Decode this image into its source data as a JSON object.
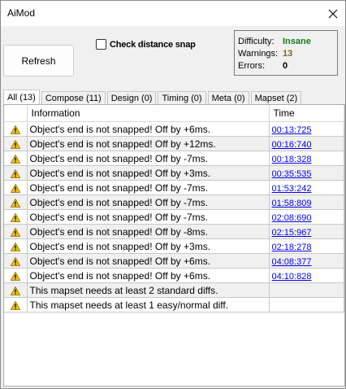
{
  "window": {
    "title": "AiMod",
    "close_glyph": "✕"
  },
  "toolbar": {
    "refresh_label": "Refresh",
    "snap_label": "Check distance snap",
    "snap_checked": false
  },
  "stats": {
    "difficulty_label": "Difficulty:",
    "difficulty_value": "Insane",
    "difficulty_color": "#1a7a1a",
    "warnings_label": "Warnings:",
    "warnings_value": "13",
    "warnings_color": "#7a6a10",
    "errors_label": "Errors:",
    "errors_value": "0"
  },
  "tabs": [
    "All (13)",
    "Compose (11)",
    "Design (0)",
    "Timing (0)",
    "Meta (0)",
    "Mapset (2)"
  ],
  "grid": {
    "columns": [
      "Information",
      "Time"
    ],
    "icon": "warning-icon",
    "rows": [
      {
        "info": "Object's end is not snapped! Off by +6ms.",
        "time": "00:13:725"
      },
      {
        "info": "Object's end is not snapped! Off by +12ms.",
        "time": "00:16:740"
      },
      {
        "info": "Object's end is not snapped! Off by -7ms.",
        "time": "00:18:328"
      },
      {
        "info": "Object's end is not snapped! Off by +3ms.",
        "time": "00:35:535"
      },
      {
        "info": "Object's end is not snapped! Off by -7ms.",
        "time": "01:53:242"
      },
      {
        "info": "Object's end is not snapped! Off by -7ms.",
        "time": "01:58:809"
      },
      {
        "info": "Object's end is not snapped! Off by -7ms.",
        "time": "02:08:690"
      },
      {
        "info": "Object's end is not snapped! Off by -8ms.",
        "time": "02:15:967"
      },
      {
        "info": "Object's end is not snapped! Off by +3ms.",
        "time": "02:18:278"
      },
      {
        "info": "Object's end is not snapped! Off by +6ms.",
        "time": "04:08:377"
      },
      {
        "info": "Object's end is not snapped! Off by +6ms.",
        "time": "04:10:828"
      },
      {
        "info": "This mapset needs at least 2 standard diffs.",
        "time": ""
      },
      {
        "info": "This mapset needs at least 1 easy/normal diff.",
        "time": ""
      }
    ]
  }
}
